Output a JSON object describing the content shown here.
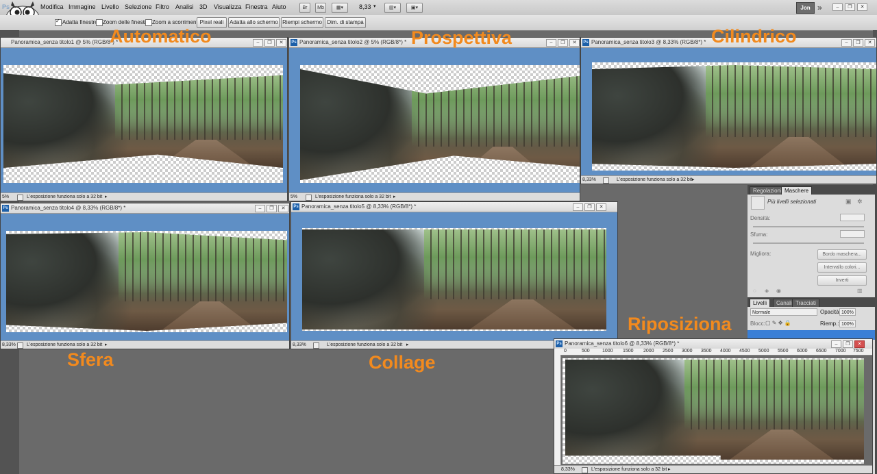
{
  "menubar": {
    "app_icon": "Ps",
    "items": [
      "Modifica",
      "Immagine",
      "Livello",
      "Selezione",
      "Filtro",
      "Analisi",
      "3D",
      "Visualizza",
      "Finestra",
      "Aiuto"
    ],
    "bridge_btn": "Br",
    "minibridge_btn": "Mb",
    "zoom_value": "8,33",
    "workspace_user": "Jon",
    "more_icon": "double-chevron-right-icon"
  },
  "options": {
    "adatta_finestre": "Adatta finestre",
    "zoom_finestre": "Zoom delle finestre",
    "zoom_scorrimento": "Zoom a scorrimento",
    "btn_pixel_reali": "Pixel reali",
    "btn_adatta_schermo": "Adatta allo schermo",
    "btn_riempi_schermo": "Riempi schermo",
    "btn_dim_stampa": "Dim. di stampa"
  },
  "windows": [
    {
      "title": "Panoramica_senza titolo1 @ 5% (RGB/8*) *",
      "zoom": "5%",
      "status": "L'esposizione funziona solo a 32 bit",
      "label": "Automatico"
    },
    {
      "title": "Panoramica_senza titolo2 @ 5% (RGB/8*) *",
      "zoom": "5%",
      "status": "L'esposizione funziona solo a 32 bit",
      "label": "Prospettiva"
    },
    {
      "title": "Panoramica_senza titolo3 @ 8,33% (RGB/8*) *",
      "zoom": "8,33%",
      "status": "L'esposizione funziona solo a 32 bit",
      "label": "Cilindrico"
    },
    {
      "title": "Panoramica_senza titolo4 @ 8,33% (RGB/8*) *",
      "zoom": "8,33%",
      "status": "L'esposizione funziona solo a 32 bit",
      "label": "Sfera"
    },
    {
      "title": "Panoramica_senza titolo5 @ 8,33% (RGB/8*) *",
      "zoom": "8,33%",
      "status": "L'esposizione funziona solo a 32 bit",
      "label": "Collage"
    },
    {
      "title": "Panoramica_senza titolo6 @ 8,33% (RGB/8*) *",
      "zoom": "8,33%",
      "status": "L'esposizione funziona solo a 32 bit",
      "label": "Riposiziona"
    }
  ],
  "ruler_ticks": [
    "0",
    "500",
    "1000",
    "1500",
    "2000",
    "2500",
    "3000",
    "3500",
    "4000",
    "4500",
    "5000",
    "5500",
    "6000",
    "6500",
    "7000",
    "7500"
  ],
  "adjust_panel": {
    "tab_regolazioni": "Regolazioni",
    "tab_maschere": "Maschere",
    "status": "Più livelli selezionati",
    "densita": "Densità:",
    "sfuma": "Sfuma:",
    "migliora": "Migliora:",
    "btn_bordo": "Bordo maschera...",
    "btn_intervallo": "Intervallo colori...",
    "btn_inverti": "Inverti"
  },
  "layers_panel": {
    "tab_livelli": "Livelli",
    "tab_canali": "Canali",
    "tab_tracciati": "Tracciati",
    "blend_mode": "Normale",
    "opacita_label": "Opacità:",
    "opacita_value": "100%",
    "blocca_label": "Blocc:",
    "riemp_label": "Riemp.:",
    "riemp_value": "100%"
  }
}
